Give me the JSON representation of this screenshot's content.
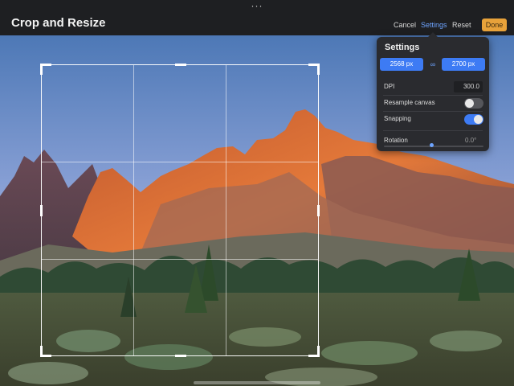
{
  "header": {
    "title": "Crop and Resize",
    "more_icon": "···",
    "cancel_label": "Cancel",
    "settings_label": "Settings",
    "reset_label": "Reset",
    "done_label": "Done"
  },
  "settings_panel": {
    "title": "Settings",
    "width": "2568 px",
    "height": "2700 px",
    "link_icon": "∞",
    "dpi_label": "DPI",
    "dpi_value": "300.0",
    "resample_label": "Resample canvas",
    "resample_on": false,
    "snapping_label": "Snapping",
    "snapping_on": true,
    "rotation_label": "Rotation",
    "rotation_value": "0.0°"
  },
  "colors": {
    "accent_blue": "#3d7bf4",
    "done_orange": "#e8a23a",
    "panel_bg": "#2a2b2f"
  }
}
